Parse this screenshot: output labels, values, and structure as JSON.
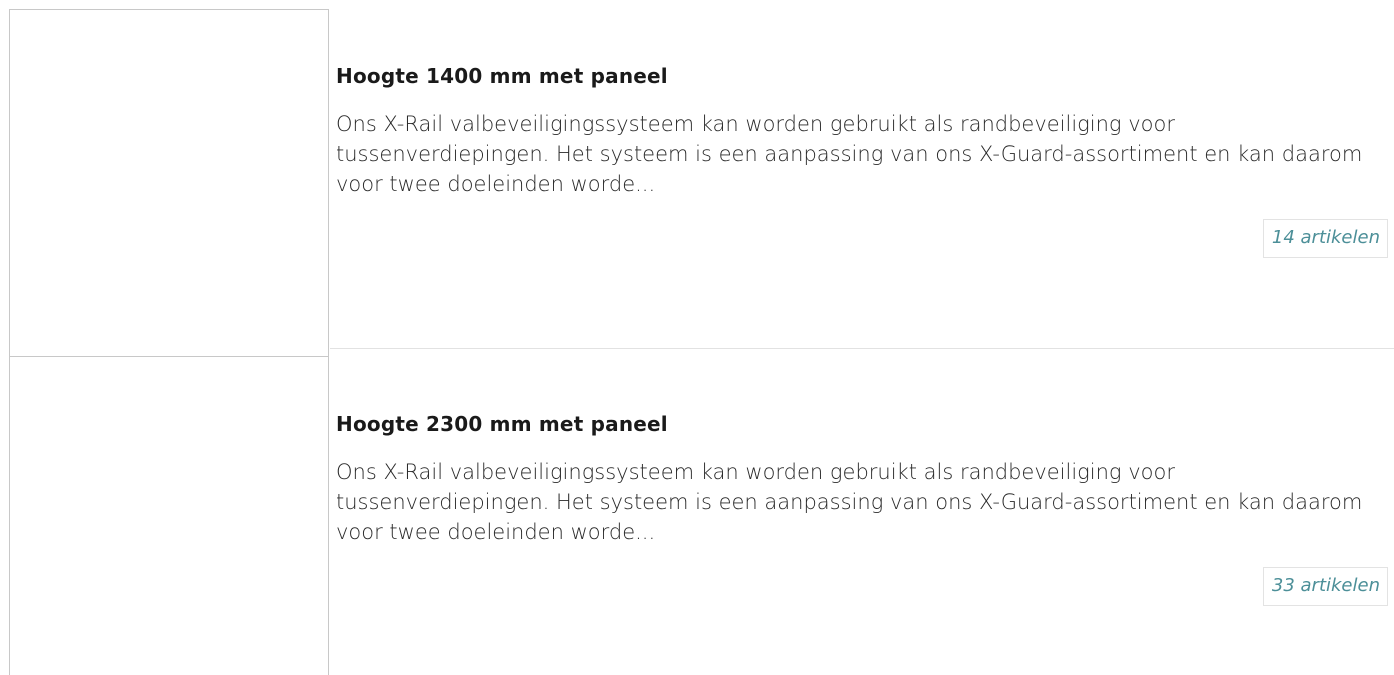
{
  "items": [
    {
      "title": "Hoogte 1400 mm met paneel",
      "description": "Ons X-Rail valbeveiligingssysteem kan worden gebruikt als randbeveiliging voor tussenverdiepingen. Het systeem is een aanpassing van ons X-Guard-assortiment en kan daarom voor twee doeleinden worde...",
      "count_label": "14 artikelen"
    },
    {
      "title": "Hoogte 2300 mm met paneel",
      "description": "Ons X-Rail valbeveiligingssysteem kan worden gebruikt als randbeveiliging voor tussenverdiepingen. Het systeem is een aanpassing van ons X-Guard-assortiment en kan daarom voor twee doeleinden worde...",
      "count_label": "33 artikelen"
    }
  ],
  "colors": {
    "count_link": "#4c8f98",
    "border": "#c8c8c8",
    "separator": "#e2e2e2"
  }
}
